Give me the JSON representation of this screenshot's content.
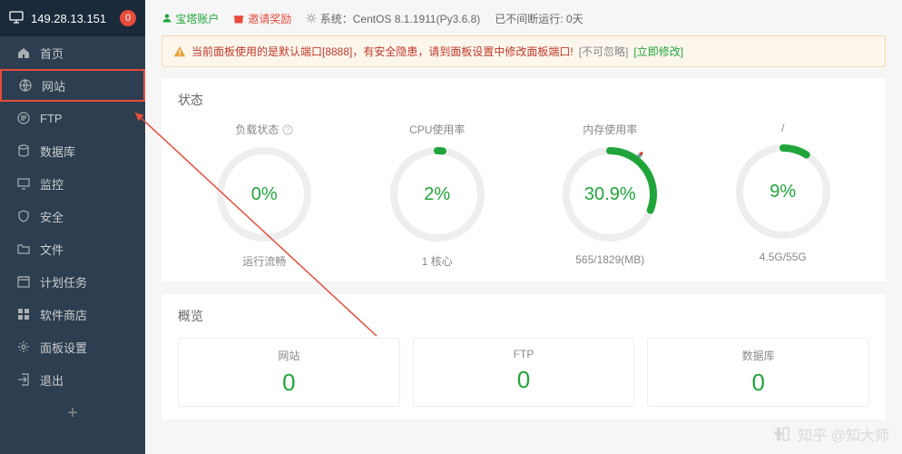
{
  "header": {
    "ip": "149.28.13.151",
    "badge": "0"
  },
  "sidebar": {
    "items": [
      {
        "label": "首页",
        "icon": "home"
      },
      {
        "label": "网站",
        "icon": "globe",
        "highlighted": true
      },
      {
        "label": "FTP",
        "icon": "ftp"
      },
      {
        "label": "数据库",
        "icon": "db"
      },
      {
        "label": "监控",
        "icon": "monitor"
      },
      {
        "label": "安全",
        "icon": "shield"
      },
      {
        "label": "文件",
        "icon": "folder"
      },
      {
        "label": "计划任务",
        "icon": "schedule"
      },
      {
        "label": "软件商店",
        "icon": "grid"
      },
      {
        "label": "面板设置",
        "icon": "gear"
      },
      {
        "label": "退出",
        "icon": "exit"
      }
    ]
  },
  "topbar": {
    "account": "宝塔账户",
    "invite": "邀请奖励",
    "system_label": "系统：",
    "system_value": "CentOS 8.1.1911(Py3.6.8)",
    "uptime_label": "已不间断运行:",
    "uptime_value": "0天"
  },
  "alert": {
    "text": "当前面板使用的是默认端口[8888]，有安全隐患，请到面板设置中修改面板端口!",
    "note": "[不可忽略]",
    "action": "[立即修改]"
  },
  "status": {
    "title": "状态",
    "gauges": [
      {
        "title": "负载状态",
        "percent": 0,
        "value": "0%",
        "sub": "运行流畅",
        "color": "#20a53a",
        "info": true
      },
      {
        "title": "CPU使用率",
        "percent": 2,
        "value": "2%",
        "sub": "1 核心",
        "color": "#20a53a"
      },
      {
        "title": "内存使用率",
        "percent": 30.9,
        "value": "30.9%",
        "sub": "565/1829(MB)",
        "color": "#20a53a",
        "rocket": true
      },
      {
        "title": "/",
        "percent": 9,
        "value": "9%",
        "sub": "4.5G/55G",
        "color": "#20a53a"
      }
    ]
  },
  "overview": {
    "title": "概览",
    "cards": [
      {
        "label": "网站",
        "value": "0"
      },
      {
        "label": "FTP",
        "value": "0"
      },
      {
        "label": "数据库",
        "value": "0"
      }
    ]
  },
  "watermark": "知乎 @知大师"
}
